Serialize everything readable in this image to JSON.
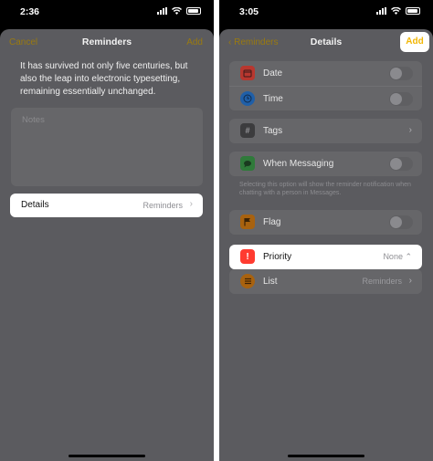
{
  "left": {
    "status_time": "2:36",
    "nav": {
      "cancel": "Cancel",
      "title": "Reminders",
      "add": "Add"
    },
    "notes_text": "It has survived not only five centuries, but also the leap into electronic typesetting, remaining essentially unchanged.",
    "notes_placeholder": "Notes",
    "details": {
      "label": "Details",
      "value": "Reminders",
      "chevron": "›"
    }
  },
  "right": {
    "status_time": "3:05",
    "nav": {
      "back": "‹ Reminders",
      "title": "Details",
      "add": "Add"
    },
    "rows": {
      "date": "Date",
      "time": "Time",
      "tags": "Tags",
      "when_messaging": "When Messaging",
      "flag": "Flag",
      "priority": "Priority",
      "priority_value": "None ⌃",
      "list": "List",
      "list_value": "Reminders"
    },
    "messaging_footnote": "Selecting this option will show the reminder notification when chatting with a person in Messages.",
    "icons": {
      "date": "calendar-icon",
      "time": "clock-icon",
      "tags": "hashtag-icon",
      "when_messaging": "messages-icon",
      "flag": "flag-icon",
      "priority": "exclamation-icon",
      "list": "list-icon"
    },
    "colors": {
      "accent": "#f2b705",
      "priority_red": "#ff3b30"
    }
  }
}
